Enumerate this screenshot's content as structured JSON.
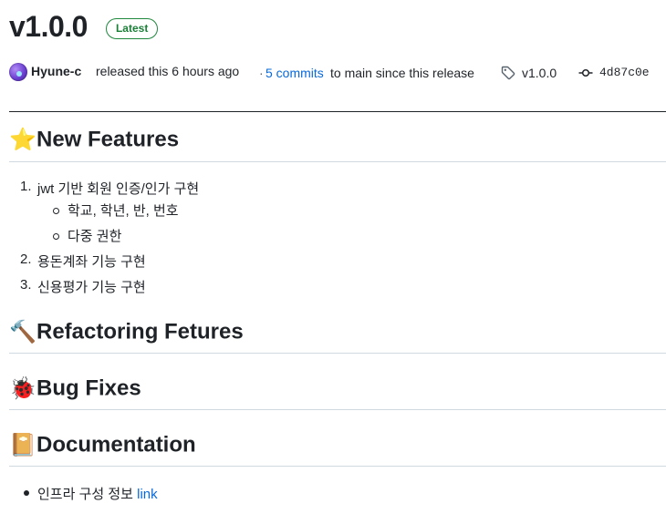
{
  "release": {
    "title": "v1.0.0",
    "badge": "Latest"
  },
  "meta": {
    "author": "Hyune-c",
    "released_text": "released this 6 hours ago",
    "separator": "·",
    "commits_link": "5 commits",
    "commits_text": "to main since this release",
    "tag": "v1.0.0",
    "commit_sha": "4d87c0e"
  },
  "sections": {
    "new_features": {
      "emoji": "⭐",
      "title": "New Features",
      "items": [
        {
          "num": "1.",
          "text": "jwt 기반 회원 인증/인가 구현",
          "sub": [
            "학교, 학년, 반, 번호",
            "다중 권한"
          ]
        },
        {
          "num": "2.",
          "text": "용돈계좌 기능 구현"
        },
        {
          "num": "3.",
          "text": "신용평가 기능 구현"
        }
      ]
    },
    "refactoring": {
      "emoji": "🔨",
      "title": "Refactoring Fetures"
    },
    "bug_fixes": {
      "emoji": "🐞",
      "title": "Bug Fixes"
    },
    "documentation": {
      "emoji": "📔",
      "title": "Documentation",
      "items": [
        {
          "text": "인프라 구성 정보",
          "link": "link"
        }
      ]
    }
  }
}
